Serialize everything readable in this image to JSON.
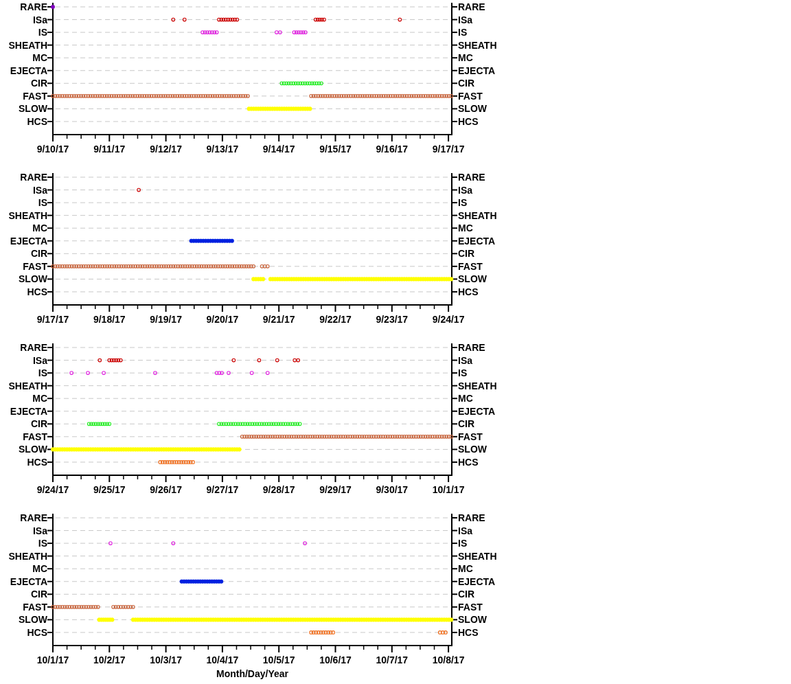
{
  "panels": [
    {
      "left_labels": [
        "RARE",
        "ISa",
        "IS",
        "SHEATH",
        "MC",
        "EJECTA",
        "CIR",
        "FAST",
        "SLOW",
        "HCS"
      ],
      "right_labels": [
        "RARE",
        "ISa",
        "IS",
        "SHEATH",
        "MC",
        "EJECTA",
        "CIR",
        "FAST",
        "SLOW",
        "HCS"
      ],
      "date_labels": [
        "9/10/17",
        "9/11/17",
        "9/12/17",
        "9/13/17",
        "9/14/17",
        "9/15/17",
        "9/16/17",
        "9/17/17"
      ]
    },
    {
      "left_labels": [
        "RARE",
        "ISa",
        "IS",
        "SHEATH",
        "MC",
        "EJECTA",
        "CIR",
        "FAST",
        "SLOW",
        "HCS"
      ],
      "right_labels": [
        "RARE",
        "ISa",
        "IS",
        "SHEATH",
        "MC",
        "EJECTA",
        "CIR",
        "FAST",
        "SLOW",
        "HCS"
      ],
      "date_labels": [
        "9/17/17",
        "9/18/17",
        "9/19/17",
        "9/20/17",
        "9/21/17",
        "9/22/17",
        "9/23/17",
        "9/24/17"
      ]
    },
    {
      "left_labels": [
        "RARE",
        "ISa",
        "IS",
        "SHEATH",
        "MC",
        "EJECTA",
        "CIR",
        "FAST",
        "SLOW",
        "HCS"
      ],
      "right_labels": [
        "RARE",
        "ISa",
        "IS",
        "SHEATH",
        "MC",
        "EJECTA",
        "CIR",
        "FAST",
        "SLOW",
        "HCS"
      ],
      "date_labels": [
        "9/24/17",
        "9/25/17",
        "9/26/17",
        "9/27/17",
        "9/28/17",
        "9/29/17",
        "9/30/17",
        "10/1/17"
      ]
    },
    {
      "left_labels": [
        "RARE",
        "ISa",
        "IS",
        "SHEATH",
        "MC",
        "EJECTA",
        "CIR",
        "FAST",
        "SLOW",
        "HCS"
      ],
      "right_labels": [
        "RARE",
        "ISa",
        "IS",
        "SHEATH",
        "MC",
        "EJECTA",
        "CIR",
        "FAST",
        "SLOW",
        "HCS"
      ],
      "date_labels": [
        "10/1/17",
        "10/2/17",
        "10/3/17",
        "10/4/17",
        "10/5/17",
        "10/6/17",
        "10/7/17",
        "10/8/17"
      ]
    }
  ],
  "x_axis_title": "Month/Day/Year"
}
